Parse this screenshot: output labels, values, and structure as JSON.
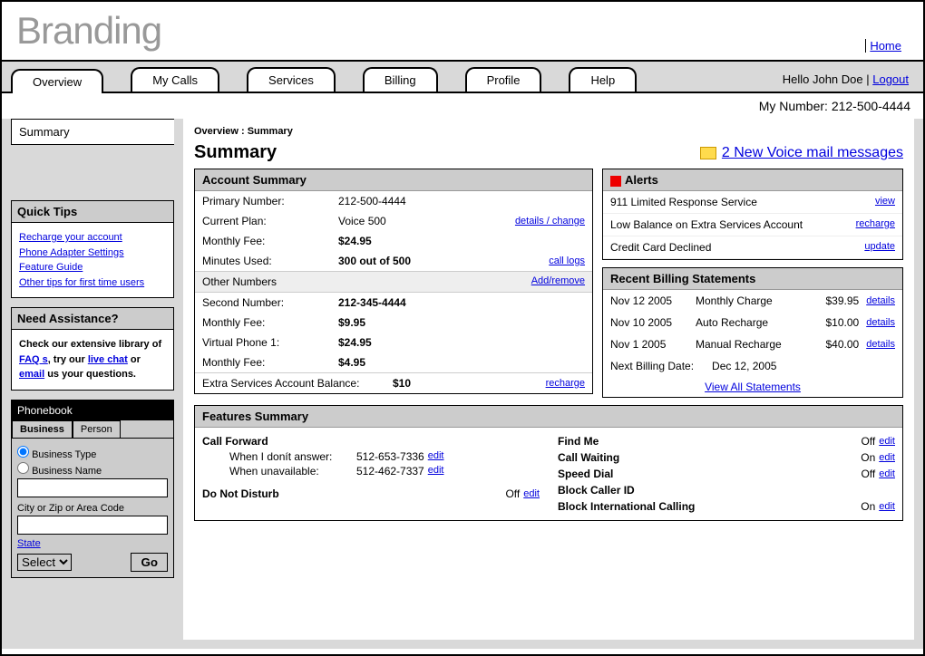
{
  "brand": "Branding",
  "home": "Home",
  "tabs": [
    "Overview",
    "My Calls",
    "Services",
    "Billing",
    "Profile",
    "Help"
  ],
  "user_greeting": "Hello John Doe",
  "logout": "Logout",
  "my_number_label": "My Number:",
  "my_number": "212-500-4444",
  "sidebar": {
    "summary": "Summary",
    "quick_tips": {
      "title": "Quick Tips",
      "links": [
        "Recharge your account",
        "Phone Adapter Settings",
        "Feature Guide",
        "Other tips for first time users"
      ]
    },
    "assist": {
      "title": "Need Assistance?",
      "text_prefix": "Check our extensive library of ",
      "faq": "FAQ s",
      "mid1": ", try our ",
      "livechat": "live chat",
      "mid2": " or ",
      "email": "email",
      "suffix": " us your questions."
    },
    "phonebook": {
      "title": "Phonebook",
      "tabs": [
        "Business",
        "Person"
      ],
      "opt_type": "Business Type",
      "opt_name": "Business Name",
      "city_label": "City or Zip or Area Code",
      "state": "State",
      "select": "Select",
      "go": "Go"
    }
  },
  "breadcrumb": "Overview : Summary",
  "page_title": "Summary",
  "voicemail": "2 New Voice mail messages",
  "account": {
    "title": "Account Summary",
    "primary_k": "Primary Number:",
    "primary_v": "212-500-4444",
    "plan_k": "Current Plan:",
    "plan_v": "Voice 500",
    "plan_act": "details / change",
    "fee_k": "Monthly Fee:",
    "fee_v": "$24.95",
    "min_k": "Minutes Used:",
    "min_v": "300 out of 500",
    "min_act": "call logs",
    "other_title": "Other Numbers",
    "other_act": "Add/remove",
    "second_k": "Second Number:",
    "second_v": "212-345-4444",
    "second_fee_k": "Monthly Fee:",
    "second_fee_v": "$9.95",
    "vp_k": "Virtual Phone 1:",
    "vp_v": "$24.95",
    "vp_fee_k": "Monthly Fee:",
    "vp_fee_v": "$4.95",
    "extra_k": "Extra Services Account Balance:",
    "extra_v": "$10",
    "extra_act": "recharge"
  },
  "alerts": {
    "title": "Alerts",
    "rows": [
      {
        "t": "911 Limited Response Service",
        "a": "view"
      },
      {
        "t": "Low Balance on Extra Services Account",
        "a": "recharge"
      },
      {
        "t": "Credit Card Declined",
        "a": "update"
      }
    ]
  },
  "billing": {
    "title": "Recent Billing Statements",
    "rows": [
      {
        "d": "Nov 12 2005",
        "desc": "Monthly Charge",
        "amt": "$39.95",
        "a": "details"
      },
      {
        "d": "Nov 10 2005",
        "desc": "Auto Recharge",
        "amt": "$10.00",
        "a": "details"
      },
      {
        "d": "Nov 1 2005",
        "desc": "Manual Recharge",
        "amt": "$40.00",
        "a": "details"
      }
    ],
    "next_k": "Next Billing Date:",
    "next_v": "Dec 12, 2005",
    "viewall": "View  All Statements"
  },
  "features": {
    "title": "Features Summary",
    "cf": "Call Forward",
    "cf_noans_k": "When I donít answer:",
    "cf_noans_v": "512-653-7336",
    "cf_unavail_k": "When unavailable:",
    "cf_unavail_v": "512-462-7337",
    "dnd": "Do Not Disturb",
    "dnd_v": "Off",
    "findme": "Find Me",
    "findme_v": "Off",
    "cw": "Call Waiting",
    "cw_v": "On",
    "sd": "Speed Dial",
    "sd_v": "Off",
    "bcid": "Block Caller ID",
    "bic": "Block International Calling",
    "bic_v": "On",
    "edit": "edit"
  }
}
